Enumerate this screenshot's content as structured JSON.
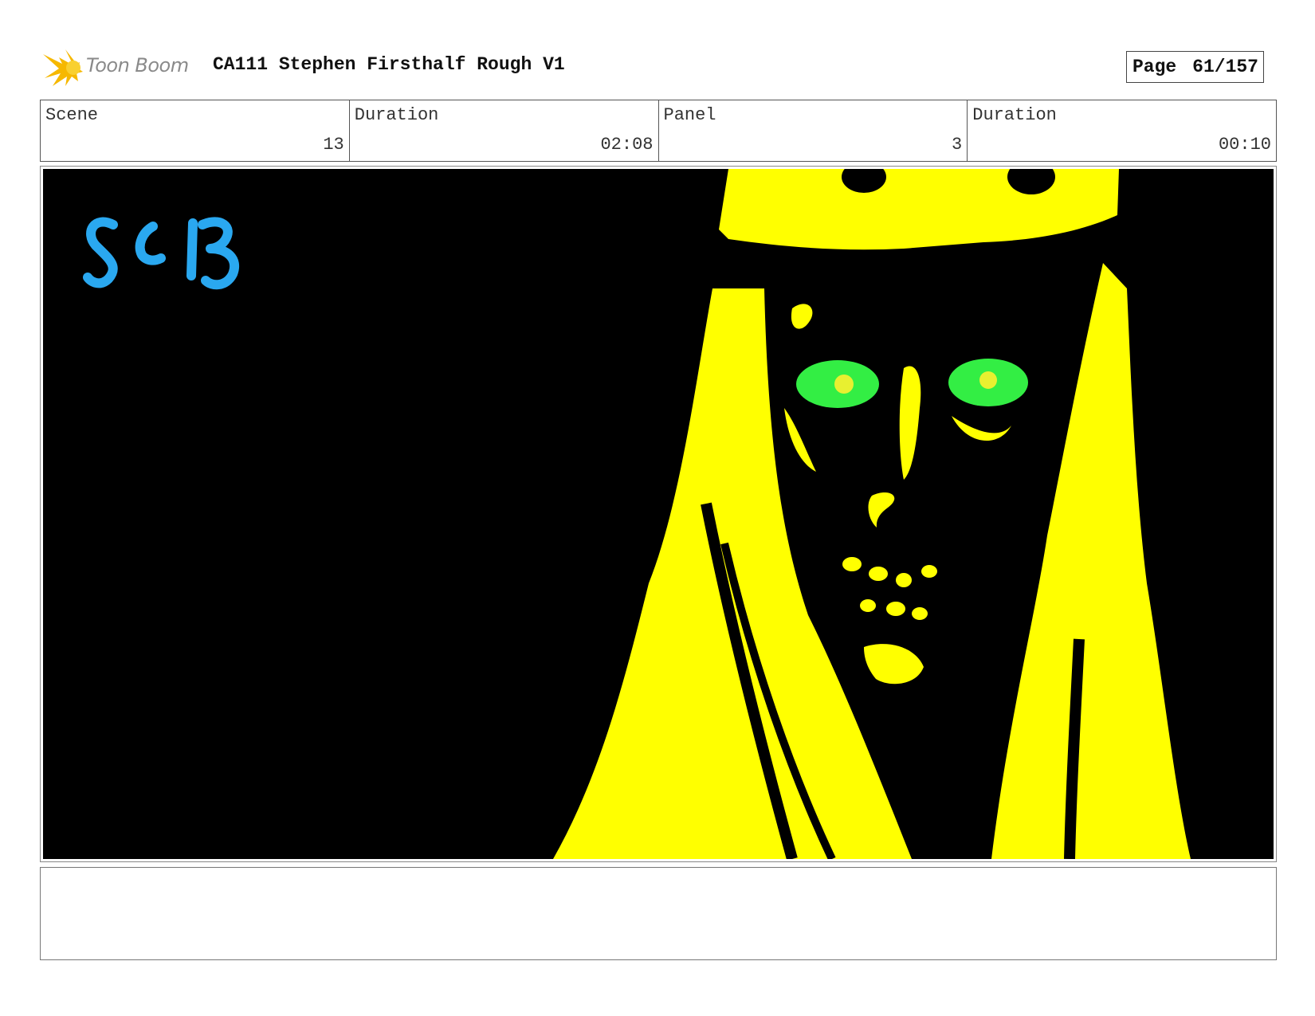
{
  "header": {
    "logo_text": "Toon Boom",
    "title": "CA111 Stephen Firsthalf Rough V1",
    "page_label": "Page",
    "page_value": "61/157"
  },
  "info": {
    "scene_label": "Scene",
    "scene_value": "13",
    "scene_duration_label": "Duration",
    "scene_duration_value": "02:08",
    "panel_label": "Panel",
    "panel_value": "3",
    "panel_duration_label": "Duration",
    "panel_duration_value": "00:10"
  },
  "panel": {
    "scene_tag": "SC13",
    "colors": {
      "background": "#000000",
      "figure": "#ffff00",
      "eyes": "#33ee44",
      "tag": "#2aa8f0"
    }
  },
  "notes": {
    "text": ""
  }
}
